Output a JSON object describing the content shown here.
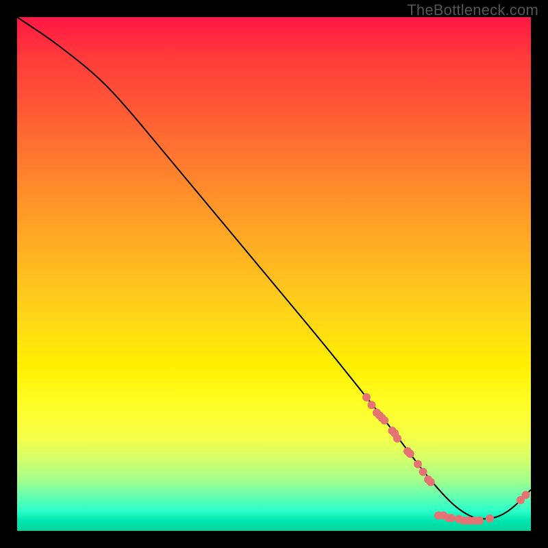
{
  "watermark": "TheBottleneck.com",
  "chart_data": {
    "type": "line",
    "title": "",
    "xlabel": "",
    "ylabel": "",
    "xlim": [
      0,
      100
    ],
    "ylim": [
      0,
      100
    ],
    "grid": false,
    "legend": false,
    "series": [
      {
        "name": "curve",
        "color": "#000000",
        "x": [
          0,
          3,
          6,
          10,
          15,
          20,
          30,
          40,
          50,
          60,
          68,
          72,
          75,
          78,
          82,
          86,
          90,
          95,
          100
        ],
        "y": [
          100,
          98,
          96,
          93,
          89,
          84,
          72,
          60,
          48,
          36,
          26,
          21,
          17,
          13,
          8,
          4,
          2,
          3,
          8
        ]
      }
    ],
    "scatter": {
      "name": "markers",
      "color": "#e57373",
      "radius": 6,
      "points": [
        {
          "x": 68,
          "y": 26
        },
        {
          "x": 69,
          "y": 24.5
        },
        {
          "x": 70,
          "y": 23
        },
        {
          "x": 71,
          "y": 22
        },
        {
          "x": 73,
          "y": 19.5
        },
        {
          "x": 74,
          "y": 18
        },
        {
          "x": 71.5,
          "y": 21.5
        },
        {
          "x": 73.5,
          "y": 19
        },
        {
          "x": 70.5,
          "y": 22.5
        },
        {
          "x": 76,
          "y": 15.5
        },
        {
          "x": 76.5,
          "y": 15
        },
        {
          "x": 78,
          "y": 13
        },
        {
          "x": 79,
          "y": 11.5
        },
        {
          "x": 80,
          "y": 10
        },
        {
          "x": 80.5,
          "y": 9.5
        },
        {
          "x": 82,
          "y": 3
        },
        {
          "x": 83,
          "y": 3
        },
        {
          "x": 84,
          "y": 2.5
        },
        {
          "x": 84.5,
          "y": 2.5
        },
        {
          "x": 86,
          "y": 2.3
        },
        {
          "x": 87,
          "y": 2
        },
        {
          "x": 88,
          "y": 2
        },
        {
          "x": 89,
          "y": 2
        },
        {
          "x": 90,
          "y": 2
        },
        {
          "x": 92,
          "y": 2.4
        },
        {
          "x": 98,
          "y": 6
        },
        {
          "x": 99,
          "y": 7
        }
      ]
    }
  }
}
